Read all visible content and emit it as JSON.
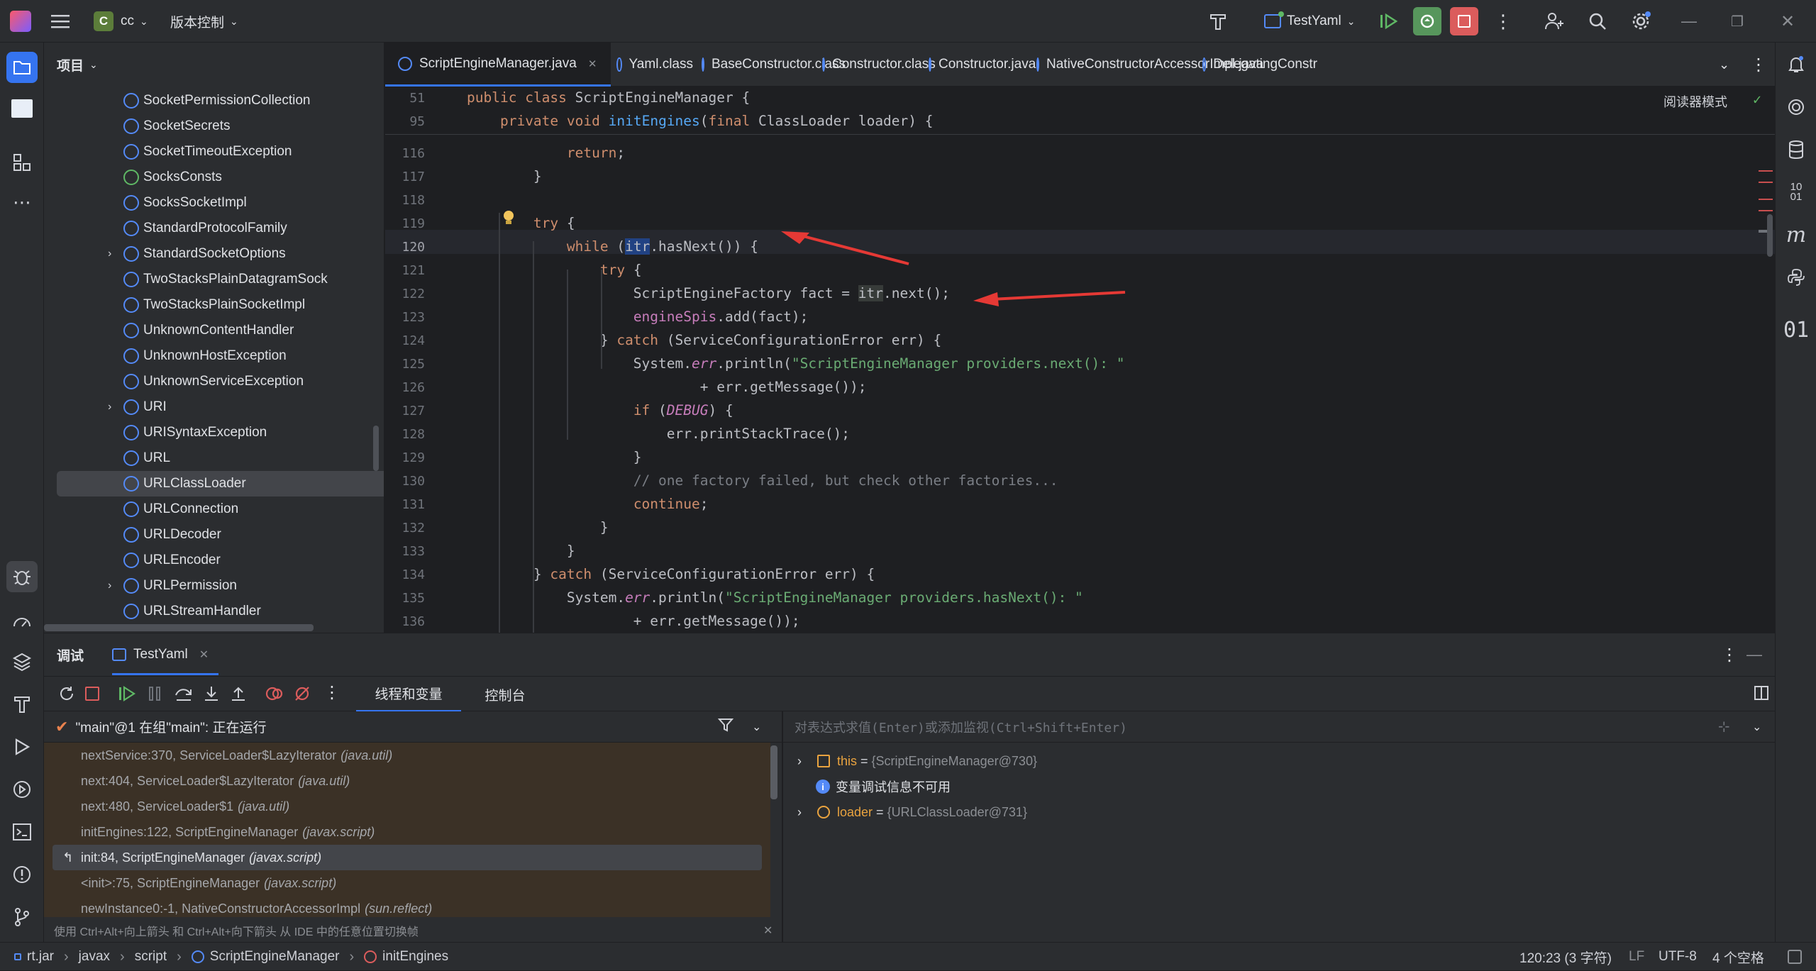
{
  "topbar": {
    "project_badge": "C",
    "project_name": "cc",
    "vcs_label": "版本控制",
    "run_config": "TestYaml"
  },
  "project_panel": {
    "title": "项目",
    "items": [
      {
        "label": "SocketPermissionCollection",
        "icon": "class-icon",
        "expand": false
      },
      {
        "label": "SocketSecrets",
        "icon": "class-icon",
        "expand": false
      },
      {
        "label": "SocketTimeoutException",
        "icon": "exception-icon",
        "expand": false
      },
      {
        "label": "SocksConsts",
        "icon": "interface-icon",
        "expand": false
      },
      {
        "label": "SocksSocketImpl",
        "icon": "class-icon",
        "expand": false
      },
      {
        "label": "StandardProtocolFamily",
        "icon": "enum-icon",
        "expand": false
      },
      {
        "label": "StandardSocketOptions",
        "icon": "class-icon",
        "expand": true
      },
      {
        "label": "TwoStacksPlainDatagramSock",
        "icon": "class-icon",
        "expand": false
      },
      {
        "label": "TwoStacksPlainSocketImpl",
        "icon": "class-icon",
        "expand": false
      },
      {
        "label": "UnknownContentHandler",
        "icon": "class-icon",
        "expand": false
      },
      {
        "label": "UnknownHostException",
        "icon": "exception-icon",
        "expand": false
      },
      {
        "label": "UnknownServiceException",
        "icon": "exception-icon",
        "expand": false
      },
      {
        "label": "URI",
        "icon": "class-icon",
        "expand": true
      },
      {
        "label": "URISyntaxException",
        "icon": "exception-icon",
        "expand": false
      },
      {
        "label": "URL",
        "icon": "class-icon",
        "expand": false
      },
      {
        "label": "URLClassLoader",
        "icon": "class-icon",
        "expand": false,
        "selected": true
      },
      {
        "label": "URLConnection",
        "icon": "class-icon",
        "expand": false
      },
      {
        "label": "URLDecoder",
        "icon": "class-icon",
        "expand": false
      },
      {
        "label": "URLEncoder",
        "icon": "class-icon",
        "expand": false
      },
      {
        "label": "URLPermission",
        "icon": "class-icon",
        "expand": true
      },
      {
        "label": "URLStreamHandler",
        "icon": "class-icon",
        "expand": false
      }
    ]
  },
  "editor_tabs": [
    {
      "label": "ScriptEngineManager.java",
      "active": true
    },
    {
      "label": "Yaml.class"
    },
    {
      "label": "BaseConstructor.class"
    },
    {
      "label": "Constructor.class"
    },
    {
      "label": "Constructor.java"
    },
    {
      "label": "NativeConstructorAccessorImpl.java"
    },
    {
      "label": "DelegatingConstr"
    }
  ],
  "editor": {
    "reader_mode": "阅读器模式",
    "sticky": [
      {
        "num": "51",
        "text": "public class ScriptEngineManager {"
      },
      {
        "num": "95",
        "text": "    private void initEngines(final ClassLoader loader) {"
      }
    ],
    "lines": [
      {
        "num": "116",
        "html": "            <span class=\"kw\">return</span>;"
      },
      {
        "num": "117",
        "html": "        }"
      },
      {
        "num": "118",
        "html": ""
      },
      {
        "num": "119",
        "html": "        <span class=\"kw\">try</span> {"
      },
      {
        "num": "120",
        "html": "            <span class=\"kw\">while</span> (<span style=\"background:#214283\">itr</span>.hasNext()) {"
      },
      {
        "num": "121",
        "html": "                <span class=\"kw\">try</span> {"
      },
      {
        "num": "122",
        "html": "                    ScriptEngineFactory fact = <span style=\"background:#373b39\">itr</span>.next();"
      },
      {
        "num": "123",
        "html": "                    <span class=\"fld\">engineSpis</span>.add(fact);"
      },
      {
        "num": "124",
        "html": "                } <span class=\"kw\">catch</span> (ServiceConfigurationError err) {"
      },
      {
        "num": "125",
        "html": "                    System.<span class=\"fld it\">err</span>.println(<span class=\"str\">\"ScriptEngineManager providers.next(): \"</span>"
      },
      {
        "num": "126",
        "html": "                            + err.getMessage());"
      },
      {
        "num": "127",
        "html": "                    <span class=\"kw\">if</span> (<span class=\"fld it\">DEBUG</span>) {"
      },
      {
        "num": "128",
        "html": "                        err.printStackTrace();"
      },
      {
        "num": "129",
        "html": "                    }"
      },
      {
        "num": "130",
        "html": "                    <span class=\"cm\">// one factory failed, but check other factories...</span>"
      },
      {
        "num": "131",
        "html": "                    <span class=\"kw\">continue</span>;"
      },
      {
        "num": "132",
        "html": "                }"
      },
      {
        "num": "133",
        "html": "            }"
      },
      {
        "num": "134",
        "html": "        } <span class=\"kw\">catch</span> (ServiceConfigurationError err) {"
      },
      {
        "num": "135",
        "html": "            System.<span class=\"fld it\">err</span>.println(<span class=\"str\">\"ScriptEngineManager providers.hasNext(): \"</span>"
      },
      {
        "num": "136",
        "html": "                    + err.getMessage());"
      }
    ]
  },
  "debug": {
    "title": "调试",
    "session_tab": "TestYaml",
    "subtab_threads": "线程和变量",
    "subtab_console": "控制台",
    "thread_status": "\"main\"@1 在组\"main\": 正在运行",
    "eval_placeholder": "对表达式求值(Enter)或添加监视(Ctrl+Shift+Enter)",
    "frames": [
      {
        "method": "nextService:370, ServiceLoader$LazyIterator",
        "pkg": "(java.util)"
      },
      {
        "method": "next:404, ServiceLoader$LazyIterator",
        "pkg": "(java.util)"
      },
      {
        "method": "next:480, ServiceLoader$1",
        "pkg": "(java.util)"
      },
      {
        "method": "initEngines:122, ScriptEngineManager",
        "pkg": "(javax.script)"
      },
      {
        "method": "init:84, ScriptEngineManager",
        "pkg": "(javax.script)",
        "current": true
      },
      {
        "method": "<init>:75, ScriptEngineManager",
        "pkg": "(javax.script)"
      },
      {
        "method": "newInstance0:-1, NativeConstructorAccessorImpl",
        "pkg": "(sun.reflect)"
      }
    ],
    "hint": "使用 Ctrl+Alt+向上箭头 和 Ctrl+Alt+向下箭头 从 IDE 中的任意位置切换帧",
    "vars": [
      {
        "name": "this",
        "eq": " = ",
        "value": "{ScriptEngineManager@730}"
      },
      {
        "name": "",
        "eq": "",
        "value": "变量调试信息不可用",
        "info": true
      },
      {
        "name": "loader",
        "eq": " = ",
        "value": "{URLClassLoader@731}"
      }
    ]
  },
  "statusbar": {
    "crumbs": [
      "rt.jar",
      "javax",
      "script",
      "ScriptEngineManager",
      "initEngines"
    ],
    "position": "120:23 (3 字符)",
    "line_sep": "LF",
    "encoding": "UTF-8",
    "indent": "4 个空格"
  }
}
